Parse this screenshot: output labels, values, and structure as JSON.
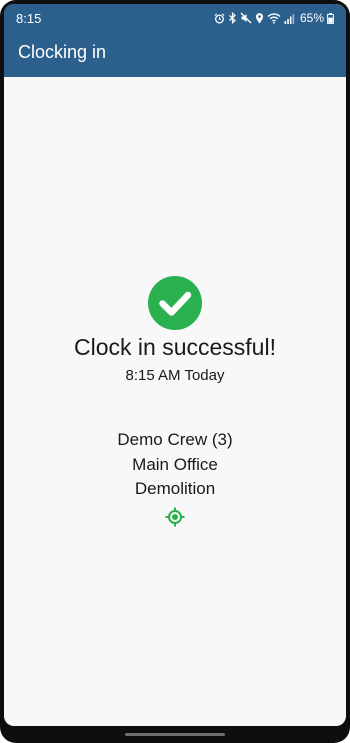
{
  "status_bar": {
    "time": "8:15",
    "battery_percent": "65%",
    "icons": [
      "alarm-icon",
      "bluetooth-icon",
      "mute-icon",
      "location-pin-icon",
      "wifi-icon",
      "signal-icon",
      "battery-icon"
    ]
  },
  "app_bar": {
    "title": "Clocking in"
  },
  "result": {
    "icon": "check-circle-icon",
    "message": "Clock in successful!",
    "time": "8:15 AM Today"
  },
  "details": {
    "crew": "Demo Crew (3)",
    "office": "Main Office",
    "task": "Demolition",
    "location_icon": "gps-target-icon"
  },
  "colors": {
    "app_bar": "#2b5f8c",
    "success": "#2ab04f",
    "background": "#f8f8f8"
  }
}
